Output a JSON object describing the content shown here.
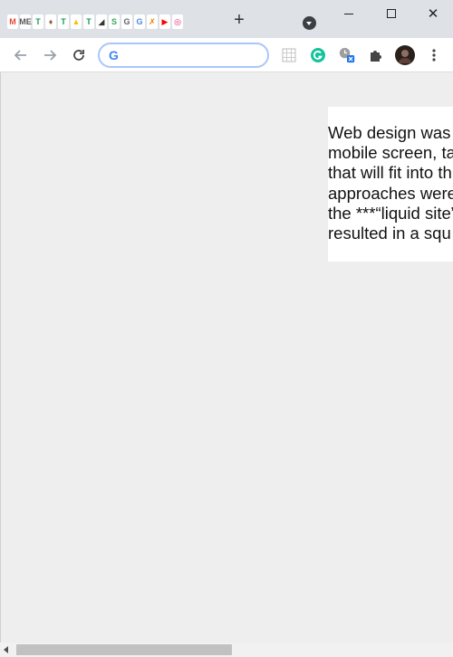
{
  "browser": {
    "tabs": [
      {
        "icon": "gmail-icon",
        "glyph": "M",
        "color": "#ea4335"
      },
      {
        "icon": "mega-icon",
        "glyph": "ME",
        "color": "#555555"
      },
      {
        "icon": "sheets-icon",
        "glyph": "T",
        "color": "#0f9d58"
      },
      {
        "icon": "figure-icon",
        "glyph": "♦",
        "color": "#8a6d3b"
      },
      {
        "icon": "sheets-icon",
        "glyph": "T",
        "color": "#0f9d58"
      },
      {
        "icon": "drive-icon",
        "glyph": "▲",
        "color": "#fbbc04"
      },
      {
        "icon": "sheets-icon",
        "glyph": "T",
        "color": "#0f9d58"
      },
      {
        "icon": "slash-app-icon",
        "glyph": "◢",
        "color": "#333333"
      },
      {
        "icon": "green-circle-icon",
        "glyph": "S",
        "color": "#34a853"
      },
      {
        "icon": "grey-app-icon",
        "glyph": "G",
        "color": "#5f6368"
      },
      {
        "icon": "google-icon",
        "glyph": "G",
        "color": "#4285f4"
      },
      {
        "icon": "bolt-icon",
        "glyph": "✗",
        "color": "#f57c00"
      },
      {
        "icon": "youtube-icon",
        "glyph": "▶",
        "color": "#ff0000"
      },
      {
        "icon": "pink-app-icon",
        "glyph": "◎",
        "color": "#e91e63"
      }
    ],
    "new_tab_label": "+",
    "close_label": "✕",
    "omnibox": {
      "value": "",
      "placeholder": ""
    }
  },
  "page": {
    "text": "Web design was\nmobile screen, ta\nthat will fit into th\napproaches were\nthe ***“liquid site”\nresulted in a squ"
  },
  "colors": {
    "tab_strip": "#dee1e6",
    "content_bg": "#eeeeee",
    "omnibox_border": "#a8c7fa",
    "grammarly": "#15c39a"
  }
}
